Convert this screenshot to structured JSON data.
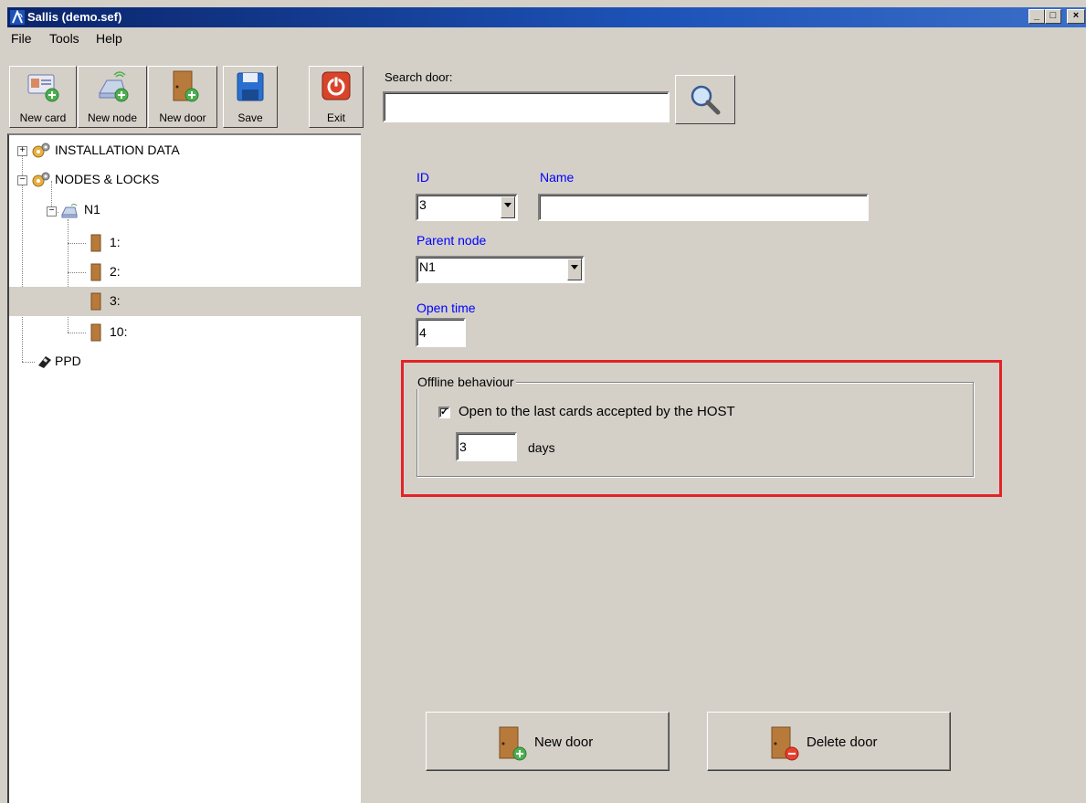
{
  "window": {
    "title": "Sallis (demo.sef)",
    "controls": [
      "_",
      "□",
      "×"
    ]
  },
  "menu": [
    "File",
    "Tools",
    "Help"
  ],
  "toolbar": {
    "buttons": [
      {
        "label": "New card",
        "icon": "new-card-icon"
      },
      {
        "label": "New node",
        "icon": "new-node-icon"
      },
      {
        "label": "New door",
        "icon": "new-door-icon"
      },
      {
        "label": "Save",
        "icon": "save-icon"
      },
      {
        "label": "Exit",
        "icon": "exit-icon"
      }
    ]
  },
  "search": {
    "label": "Search door:",
    "value": "",
    "icon": "magnifier-icon"
  },
  "tree": {
    "items": [
      {
        "label": "INSTALLATION DATA",
        "icon": "gears-icon",
        "expander": "+"
      },
      {
        "label": "NODES & LOCKS",
        "icon": "gears-icon",
        "expander": "−"
      },
      {
        "label": "N1",
        "icon": "node-icon",
        "expander": "−"
      },
      {
        "label": "1:",
        "icon": "door-icon"
      },
      {
        "label": "2:",
        "icon": "door-icon"
      },
      {
        "label": "3:",
        "icon": "door-icon",
        "selected": true
      },
      {
        "label": "10:",
        "icon": "door-icon"
      },
      {
        "label": "PPD",
        "icon": "ppd-device-icon"
      }
    ]
  },
  "form": {
    "id_label": "ID",
    "id_value": "3",
    "name_label": "Name",
    "name_value": "",
    "parent_label": "Parent node",
    "parent_value": "N1",
    "open_time_label": "Open time",
    "open_time_value": "4",
    "offline": {
      "title": "Offline behaviour",
      "checkbox_label": "Open to the last cards accepted by the HOST",
      "checked": true,
      "days_value": "3",
      "days_label": "days"
    },
    "new_door_button": "New door",
    "delete_door_button": "Delete door"
  },
  "colors": {
    "highlight_border": "#e32228",
    "label_blue": "#0000ff",
    "face": "#d4d0c8",
    "titlebar": "#0a246a"
  }
}
